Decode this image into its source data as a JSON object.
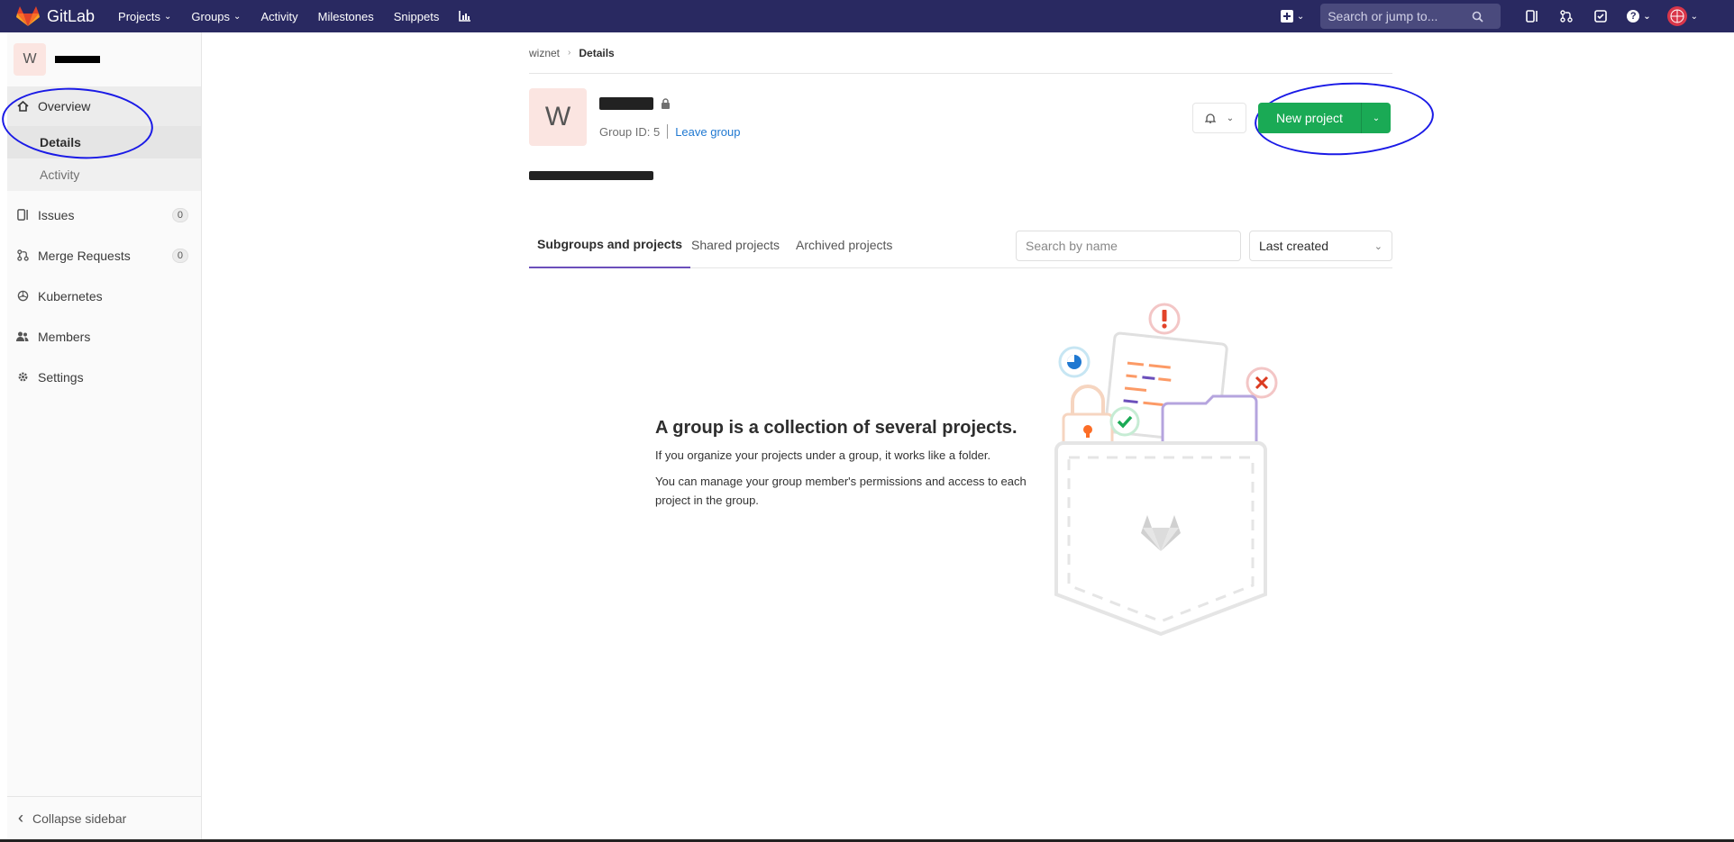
{
  "nav": {
    "brand": "GitLab",
    "items": [
      {
        "label": "Projects",
        "has_caret": true
      },
      {
        "label": "Groups",
        "has_caret": true
      },
      {
        "label": "Activity",
        "has_caret": false
      },
      {
        "label": "Milestones",
        "has_caret": false
      },
      {
        "label": "Snippets",
        "has_caret": false
      }
    ],
    "search_placeholder": "Search or jump to...",
    "colors": {
      "bar": "#292961",
      "accent": "#fc6d26"
    }
  },
  "sidebar": {
    "group_initial": "W",
    "overview_label": "Overview",
    "sub_items": [
      {
        "label": "Details",
        "active": true
      },
      {
        "label": "Activity",
        "active": false
      }
    ],
    "items": [
      {
        "label": "Issues",
        "icon": "issues-icon",
        "count": "0"
      },
      {
        "label": "Merge Requests",
        "icon": "merge-request-icon",
        "count": "0"
      },
      {
        "label": "Kubernetes",
        "icon": "kubernetes-icon",
        "count": null
      },
      {
        "label": "Members",
        "icon": "members-icon",
        "count": null
      },
      {
        "label": "Settings",
        "icon": "settings-icon",
        "count": null
      }
    ],
    "collapse_label": "Collapse sidebar"
  },
  "breadcrumb": {
    "parent": "wiznet",
    "current": "Details"
  },
  "group": {
    "initial": "W",
    "id_text": "Group ID: 5",
    "leave_label": "Leave group"
  },
  "actions": {
    "new_project_label": "New project"
  },
  "tabs": [
    {
      "label": "Subgroups and projects",
      "active": true
    },
    {
      "label": "Shared projects",
      "active": false
    },
    {
      "label": "Archived projects",
      "active": false
    }
  ],
  "filter": {
    "placeholder": "Search by name",
    "sort_selected": "Last created"
  },
  "empty_state": {
    "title": "A group is a collection of several projects.",
    "line1": "If you organize your projects under a group, it works like a folder.",
    "line2": "You can manage your group member's permissions and access to each project in the group."
  }
}
